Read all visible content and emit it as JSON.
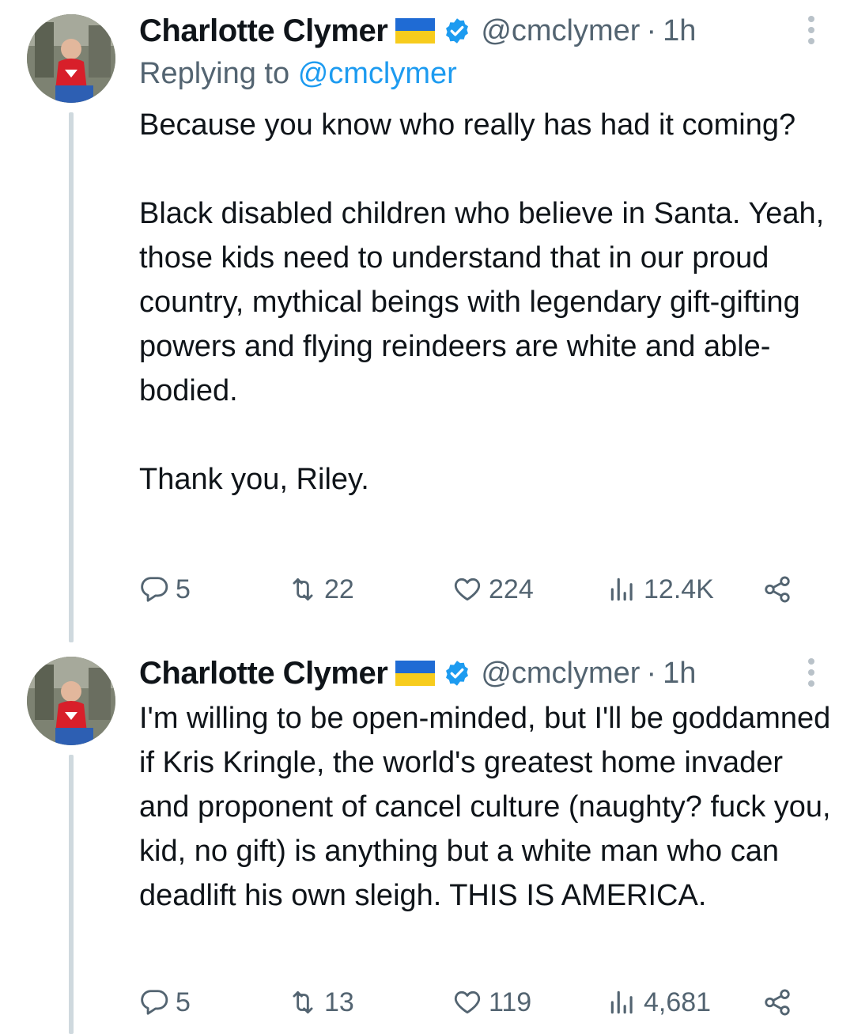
{
  "tweets": [
    {
      "author": {
        "name": "Charlotte Clymer",
        "handle": "@cmclymer",
        "time": "1h"
      },
      "replying_to": {
        "prefix": "Replying to",
        "mention": "@cmclymer"
      },
      "paragraphs": [
        "Because you know who really has had it coming?",
        "Black disabled children who believe in Santa. Yeah, those kids need to understand that in our proud country, mythical beings with legendary gift-gifting powers and flying reindeers are white and able-bodied.",
        "Thank you, Riley."
      ],
      "stats": {
        "replies": "5",
        "retweets": "22",
        "likes": "224",
        "views": "12.4K"
      }
    },
    {
      "author": {
        "name": "Charlotte Clymer",
        "handle": "@cmclymer",
        "time": "1h"
      },
      "paragraphs": [
        "I'm willing to be open-minded, but I'll be goddamned if Kris Kringle, the world's greatest home invader and proponent of cancel culture (naughty? fuck you, kid, no gift) is anything but a white man who can deadlift his own sleigh. THIS IS AMERICA."
      ],
      "stats": {
        "replies": "5",
        "retweets": "13",
        "likes": "119",
        "views": "4,681"
      }
    }
  ],
  "colors": {
    "text": "#0f1419",
    "secondary": "#536471",
    "link": "#1d9bf0",
    "verified": "#1d9bf0",
    "thread_line": "#cfd9de"
  },
  "icons": [
    "ukraine-flag-icon",
    "verified-badge-icon",
    "more-options-icon",
    "reply-icon",
    "retweet-icon",
    "like-icon",
    "views-icon",
    "share-icon"
  ]
}
